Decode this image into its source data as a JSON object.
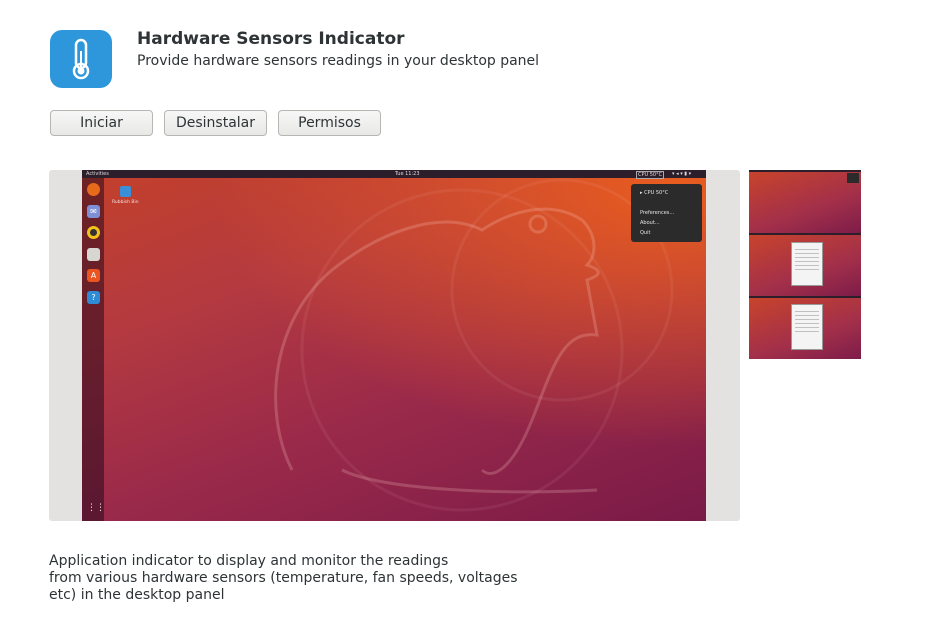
{
  "app": {
    "title": "Hardware Sensors Indicator",
    "summary": "Provide hardware sensors readings in your desktop panel",
    "icon": "thermometer-icon",
    "icon_color": "#2e97dc"
  },
  "actions": {
    "launch_label": "Iniciar",
    "uninstall_label": "Desinstalar",
    "permissions_label": "Permisos"
  },
  "screenshot": {
    "topbar": {
      "activities": "Activities",
      "clock": "Tue 11:23",
      "indicator": "CPU 50°C"
    },
    "desktop_icon_label": "Rubbish Bin",
    "menu": {
      "reading": "CPU 50°C",
      "items": [
        "Preferences...",
        "About...",
        "Quit"
      ]
    },
    "dock_icons": [
      "firefox-icon",
      "mail-icon",
      "music-icon",
      "files-icon",
      "software-icon",
      "help-icon"
    ]
  },
  "thumbnails_count": 3,
  "description": [
    "Application indicator to display and monitor the readings",
    "from various hardware sensors (temperature, fan speeds, voltages",
    "etc) in the desktop panel"
  ]
}
